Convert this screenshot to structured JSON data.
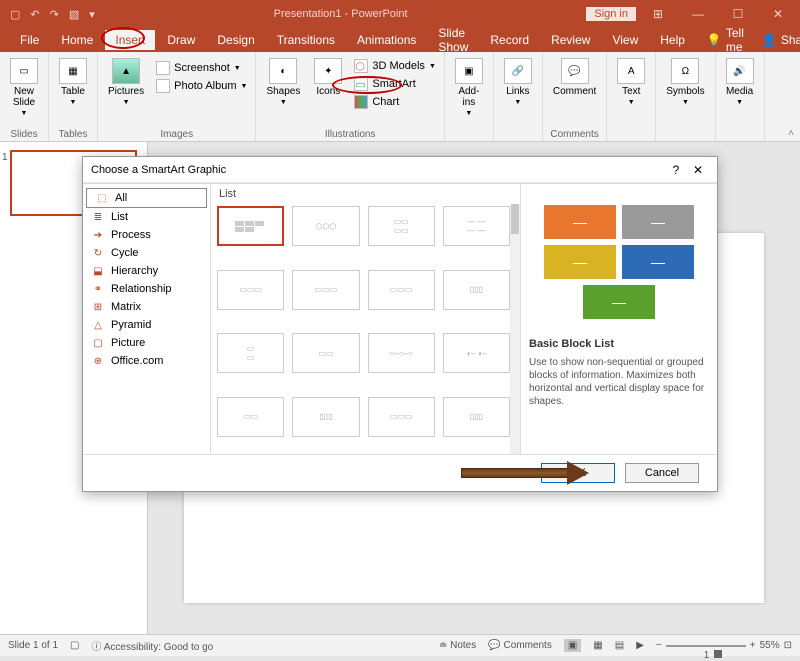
{
  "titlebar": {
    "title": "Presentation1 - PowerPoint",
    "signin": "Sign in"
  },
  "tabs": {
    "file": "File",
    "home": "Home",
    "insert": "Insert",
    "draw": "Draw",
    "design": "Design",
    "transitions": "Transitions",
    "animations": "Animations",
    "slideshow": "Slide Show",
    "record": "Record",
    "review": "Review",
    "view": "View",
    "help": "Help",
    "tellme": "Tell me",
    "share": "Share"
  },
  "ribbon": {
    "slides": {
      "newslide": "New\nSlide",
      "label": "Slides"
    },
    "tables": {
      "table": "Table",
      "label": "Tables"
    },
    "images": {
      "pictures": "Pictures",
      "screenshot": "Screenshot",
      "photoalbum": "Photo Album",
      "label": "Images"
    },
    "illustrations": {
      "shapes": "Shapes",
      "icons": "Icons",
      "models3d": "3D Models",
      "smartart": "SmartArt",
      "chart": "Chart",
      "label": "Illustrations"
    },
    "addins": {
      "addins": "Add-\nins",
      "label": ""
    },
    "links": {
      "links": "Links",
      "label": ""
    },
    "comments": {
      "comment": "Comment",
      "label": "Comments"
    },
    "text": {
      "text": "Text",
      "label": ""
    },
    "symbols": {
      "symbols": "Symbols",
      "label": ""
    },
    "media": {
      "media": "Media",
      "label": ""
    }
  },
  "dialog": {
    "title": "Choose a SmartArt Graphic",
    "categories": {
      "all": "All",
      "list": "List",
      "process": "Process",
      "cycle": "Cycle",
      "hierarchy": "Hierarchy",
      "relationship": "Relationship",
      "matrix": "Matrix",
      "pyramid": "Pyramid",
      "picture": "Picture",
      "office": "Office.com"
    },
    "gallery_header": "List",
    "preview": {
      "title": "Basic Block List",
      "desc": "Use to show non-sequential or grouped blocks of information. Maximizes both horizontal and vertical display space for shapes.",
      "colors": {
        "c1": "#e8762d",
        "c2": "#9a9a9a",
        "c3": "#d9b422",
        "c4": "#2e6bb6",
        "c5": "#5aa02c"
      }
    },
    "ok": "OK",
    "cancel": "Cancel"
  },
  "status": {
    "slide": "Slide 1 of 1",
    "lang": "",
    "accessibility": "Accessibility: Good to go",
    "notes": "Notes",
    "comments": "Comments",
    "zoom": "55%"
  }
}
